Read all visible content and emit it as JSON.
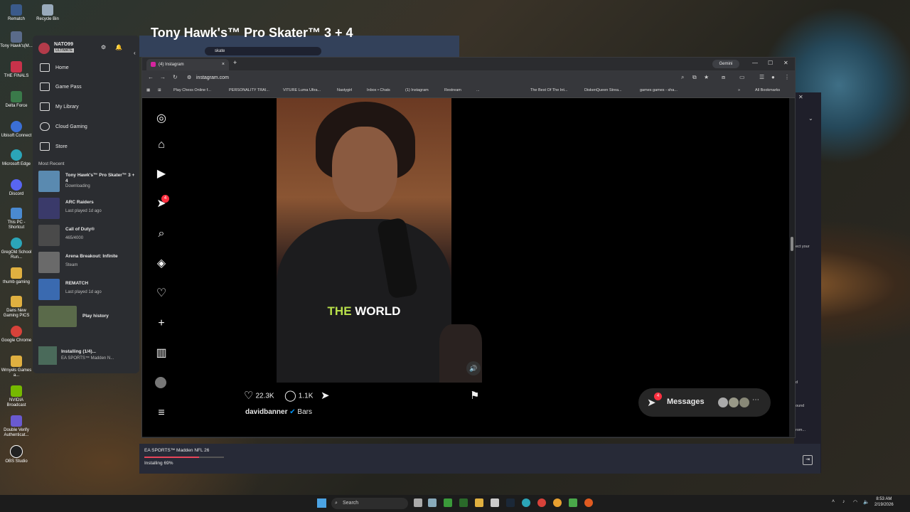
{
  "desktop": {
    "icons": [
      "Rematch",
      "Recycle Bin",
      "Tony Hawk's(M...",
      "THE FINALS",
      "Delta Force",
      "Ubisoft Connect",
      "Microsoft Edge",
      "Discord",
      "This PC - Shortcut",
      "GregOld School Run...",
      "thumb gaming",
      "Dans New Gaming PICS",
      "Google Chrome",
      "Wrnyels Games a...",
      "NVIDIA Broadcast",
      "Double Verify Authenticat...",
      "OBS Studio"
    ]
  },
  "xbox": {
    "profile": {
      "name": "NATO99",
      "tier": "ULTIMATE"
    },
    "nav": [
      "Home",
      "Game Pass",
      "My Library",
      "Cloud Gaming",
      "Store"
    ],
    "recent_heading": "Most Recent",
    "recent": [
      {
        "title": "Tony Hawk's™ Pro Skater™ 3 + 4",
        "sub": "Downloading"
      },
      {
        "title": "ARC Raiders",
        "sub": "Last played 1d ago"
      },
      {
        "title": "Call of Duty®",
        "sub": "465/4000"
      },
      {
        "title": "Arena Breakout: Infinite",
        "sub": "Steam"
      },
      {
        "title": "REMATCH",
        "sub": "Last played 1d ago"
      },
      {
        "title": "Play history",
        "sub": ""
      }
    ],
    "installing": {
      "title": "Installing (1/4)...",
      "sub": "EA SPORTS™ Madden N..."
    },
    "bg_search": "skate",
    "bg_title": "Tony Hawk's™ Pro Skater™ 3 + 4",
    "download": {
      "game": "EA SPORTS™ Madden NFL 26",
      "status": "Installing 69%",
      "progress": 0.69
    }
  },
  "browser": {
    "tab_title": "(4) Instagram",
    "gemini": "Gemini",
    "url": "instagram.com",
    "bookmarks": [
      "Play Chess Online f...",
      "PERSONALITY TRAI...",
      "VITURE Luma Ultra...",
      "Nastygirl",
      "Inbox • Chats",
      "(1) Instagram",
      "Restream",
      "...",
      "The Best Of The Int...",
      "DiskenQueen Strea...",
      "games games - sha...",
      "All Bookmarks"
    ]
  },
  "instagram": {
    "notif_count": "4",
    "caption_hl": "THE",
    "caption_rest": " WORLD",
    "likes": "22.3K",
    "comments": "1.1K",
    "username": "davidbanner",
    "verified": "✔",
    "post_caption": "Bars",
    "messages_label": "Messages",
    "messages_count": "4"
  },
  "right_fragment": [
    "ect your",
    "d",
    "ound",
    "rom..."
  ],
  "taskbar": {
    "search": "Search",
    "time": "8:53 AM",
    "date": "2/19/2026"
  },
  "colors": {
    "ig_badge": "#ff3040",
    "verified": "#0095f6",
    "caption_highlight": "#b8e04a",
    "progress": "#e8455a"
  }
}
